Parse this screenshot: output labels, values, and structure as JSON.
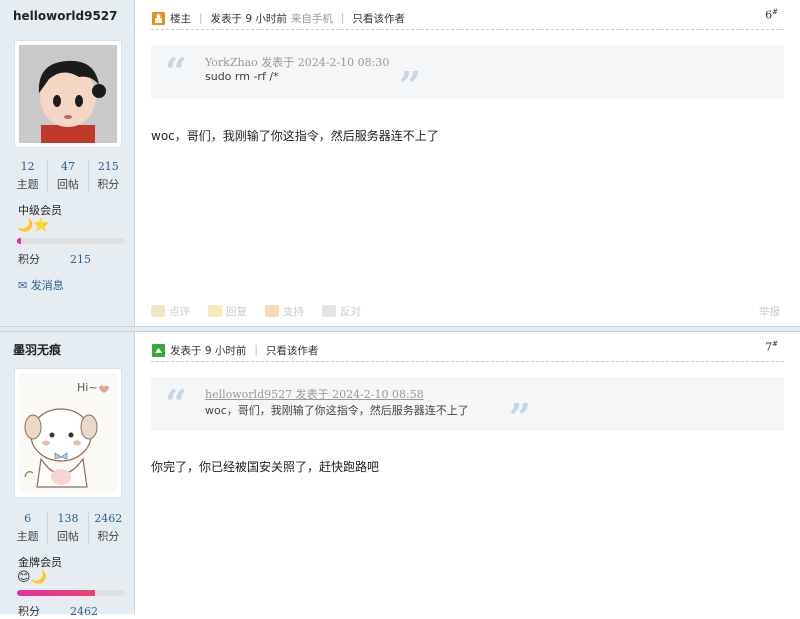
{
  "post1": {
    "username": "helloworld9527",
    "stats": [
      {
        "value": "12",
        "label": "主题"
      },
      {
        "value": "47",
        "label": "回帖"
      },
      {
        "value": "215",
        "label": "积分"
      }
    ],
    "level": "中级会员",
    "medals": "🌙⭐",
    "progress": 0.04,
    "credit_label": "积分",
    "credit_value": "215",
    "message_label": "发消息",
    "role": "楼主",
    "time": "发表于 9 小时前",
    "source": "来自手机",
    "only_author": "只看该作者",
    "floor": "6",
    "quote_author": "YorkZhao 发表于 2024-2-10 08:30",
    "quote_text": "sudo rm -rf /*",
    "content": "woc，哥们，我刚输了你这指令，然后服务器连不上了",
    "actions": [
      "点评",
      "回复",
      "支持",
      "反对"
    ],
    "report": "举报"
  },
  "post2": {
    "username": "墨羽无痕",
    "stats": [
      {
        "value": "6",
        "label": "主题"
      },
      {
        "value": "138",
        "label": "回帖"
      },
      {
        "value": "2462",
        "label": "积分"
      }
    ],
    "level": "金牌会员",
    "medals": "😊🌙",
    "progress": 0.72,
    "credit_label": "积分",
    "credit_value": "2462",
    "avatar_text": "Hi~",
    "time": "发表于 9 小时前",
    "only_author": "只看该作者",
    "floor": "7",
    "quote_author": "helloworld9527 发表于 2024-2-10 08:58",
    "quote_text": "woc，哥们，我刚输了你这指令，然后服务器连不上了",
    "content": "你完了，你已经被国安关照了，赶快跑路吧"
  },
  "colors": {
    "sidebar_bg": "#e5edf2",
    "link": "#2a5f93",
    "progress_low": "#e3319b",
    "progress_high": "#e8456f"
  },
  "icons": {
    "role_icon": "owner-badge-icon",
    "post2_icon": "green-arrow-icon",
    "message_icon": "envelope-icon"
  }
}
